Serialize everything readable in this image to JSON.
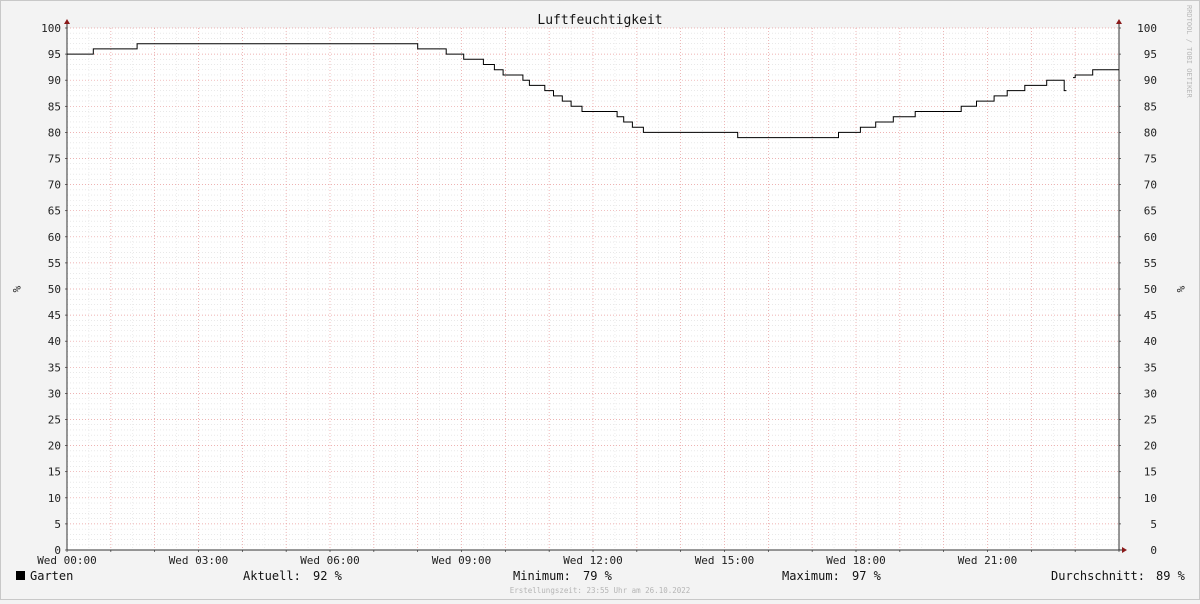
{
  "chart_data": {
    "type": "line",
    "title": "Luftfeuchtigkeit",
    "ylabel": "%",
    "ylabel_right": "%",
    "ylim": [
      0,
      100
    ],
    "y_ticks": [
      0,
      5,
      10,
      15,
      20,
      25,
      30,
      35,
      40,
      45,
      50,
      55,
      60,
      65,
      70,
      75,
      80,
      85,
      90,
      95,
      100
    ],
    "x_range_hours": [
      0,
      24
    ],
    "x_ticks": [
      {
        "hour": 0,
        "label": "Wed 00:00"
      },
      {
        "hour": 3,
        "label": "Wed 03:00"
      },
      {
        "hour": 6,
        "label": "Wed 06:00"
      },
      {
        "hour": 9,
        "label": "Wed 09:00"
      },
      {
        "hour": 12,
        "label": "Wed 12:00"
      },
      {
        "hour": 15,
        "label": "Wed 15:00"
      },
      {
        "hour": 18,
        "label": "Wed 18:00"
      },
      {
        "hour": 21,
        "label": "Wed 21:00"
      }
    ],
    "grid": true,
    "series": [
      {
        "name": "Garten",
        "color": "#000000",
        "segments": [
          [
            [
              0.0,
              95
            ],
            [
              0.6,
              96
            ],
            [
              1.6,
              97
            ],
            [
              8.0,
              96
            ],
            [
              8.65,
              95
            ],
            [
              9.05,
              94
            ],
            [
              9.5,
              93
            ],
            [
              9.75,
              92
            ],
            [
              9.95,
              91
            ],
            [
              10.4,
              90
            ],
            [
              10.55,
              89
            ],
            [
              10.9,
              88
            ],
            [
              11.1,
              87
            ],
            [
              11.3,
              86
            ],
            [
              11.5,
              85
            ],
            [
              11.75,
              84
            ],
            [
              12.55,
              83
            ],
            [
              12.7,
              82
            ],
            [
              12.9,
              81
            ],
            [
              13.15,
              80
            ],
            [
              15.3,
              79
            ],
            [
              17.6,
              80
            ],
            [
              18.1,
              81
            ],
            [
              18.45,
              82
            ],
            [
              18.85,
              83
            ],
            [
              19.35,
              84
            ],
            [
              20.4,
              85
            ],
            [
              20.75,
              86
            ],
            [
              21.15,
              87
            ],
            [
              21.45,
              88
            ],
            [
              21.85,
              89
            ],
            [
              22.35,
              90
            ],
            [
              22.75,
              88
            ],
            [
              22.8,
              88
            ]
          ],
          [
            [
              22.95,
              90.5
            ],
            [
              23.0,
              91
            ],
            [
              23.4,
              92
            ],
            [
              24.0,
              92
            ]
          ]
        ]
      }
    ],
    "legend": {
      "series_name": "Garten",
      "aktuell_label": "Aktuell:",
      "aktuell_value": "92 %",
      "minimum_label": "Minimum:",
      "minimum_value": "79 %",
      "maximum_label": "Maximum:",
      "maximum_value": "97 %",
      "durchschnitt_label": "Durchschnitt:",
      "durchschnitt_value": "89 %"
    },
    "footer": "Erstellungszeit: 23:55 Uhr am 26.10.2022",
    "watermark": "RRDTOOL / TOBI OETIKER"
  }
}
